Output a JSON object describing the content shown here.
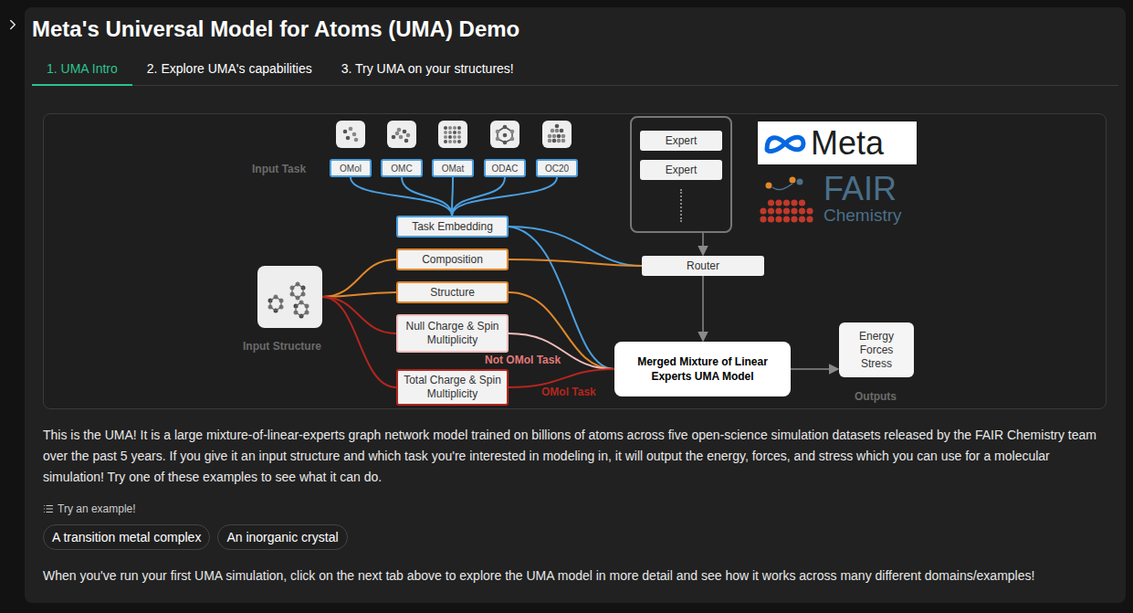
{
  "title": "Meta's Universal Model for Atoms (UMA) Demo",
  "tabs": [
    {
      "label": "1. UMA Intro",
      "selected": true
    },
    {
      "label": "2. Explore UMA's capabilities",
      "selected": false
    },
    {
      "label": "3. Try UMA on your structures!",
      "selected": false
    }
  ],
  "diagram": {
    "input_task_label": "Input Task",
    "tasks": [
      "OMol",
      "OMC",
      "OMat",
      "ODAC",
      "OC20"
    ],
    "task_embedding": "Task Embedding",
    "composition": "Composition",
    "structure": "Structure",
    "null_charge": "Null Charge & Spin Multiplicity",
    "total_charge": "Total Charge & Spin Multiplicity",
    "input_structure_label": "Input Structure",
    "not_omol_task": "Not OMol Task",
    "omol_task": "OMol Task",
    "experts": [
      "Expert",
      "Expert"
    ],
    "router": "Router",
    "merged": "Merged Mixture of Linear Experts UMA Model",
    "outputs": [
      "Energy",
      "Forces",
      "Stress"
    ],
    "outputs_label": "Outputs",
    "logo": {
      "meta": "Meta",
      "fair": "FAIR",
      "chemistry": "Chemistry"
    }
  },
  "description": "This is the UMA! It is a large mixture-of-linear-experts graph network model trained on billions of atoms across five open-science simulation datasets released by the FAIR Chemistry team over the past 5 years. If you give it an input structure and which task you're interested in modeling in, it will output the energy, forces, and stress which you can use for a molecular simulation! Try one of these examples to see what it can do.",
  "examples": {
    "label": "Try an example!",
    "items": [
      "A transition metal complex",
      "An inorganic crystal"
    ]
  },
  "footer": "When you've run your first UMA simulation, click on the next tab above to explore the UMA model in more detail and see how it works across many different domains/examples!"
}
